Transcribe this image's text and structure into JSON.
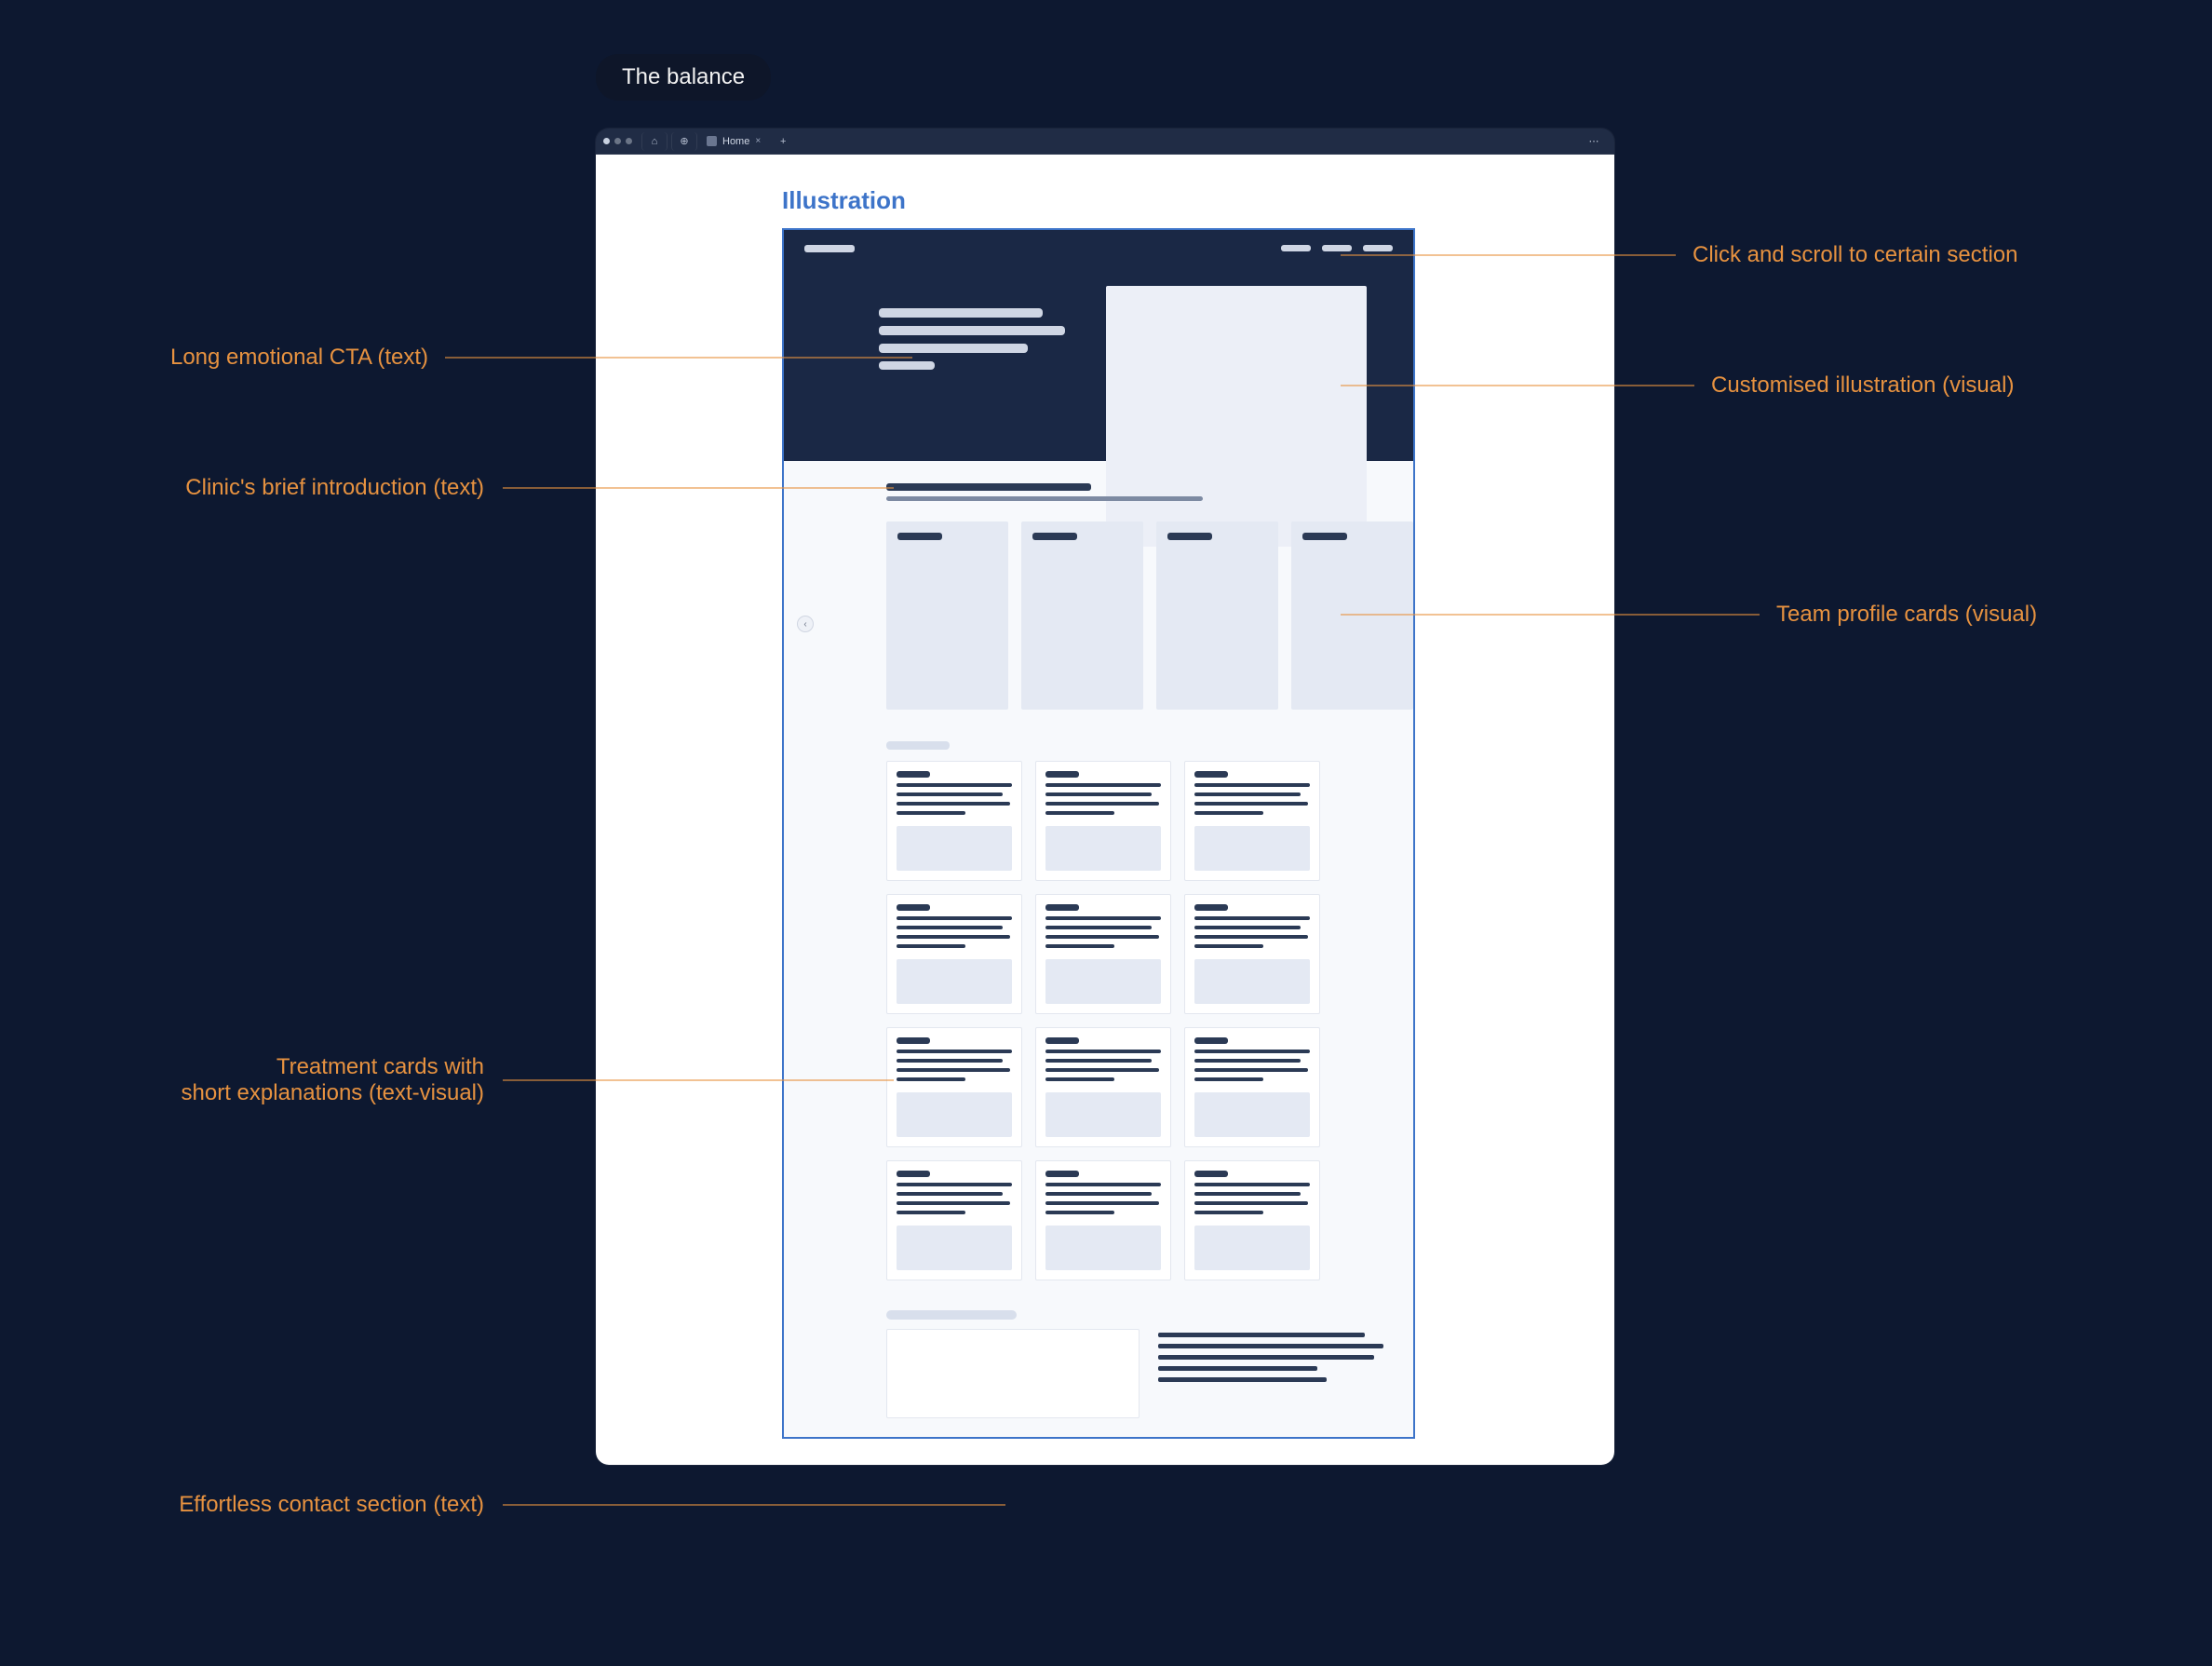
{
  "badge": "The balance",
  "browser": {
    "tab_label": "Home",
    "home_icon": "⌂",
    "globe_icon": "⊕",
    "plus_icon": "+",
    "more_icon": "⋯",
    "close_icon": "×"
  },
  "wireframe_title": "Illustration",
  "annotations": {
    "left": {
      "cta": "Long emotional CTA (text)",
      "intro": "Clinic's brief introduction (text)",
      "treatment": "Treatment cards with\nshort explanations (text-visual)",
      "contact": "Effortless contact section (text)"
    },
    "right": {
      "nav": "Click and scroll to certain section",
      "illus": "Customised illustration (visual)",
      "team": "Team profile cards (visual)"
    }
  },
  "counts": {
    "nav_items": 3,
    "cta_lines": 4,
    "team_cards": 4,
    "treatment_cards": 12,
    "contact_lines": 5
  }
}
